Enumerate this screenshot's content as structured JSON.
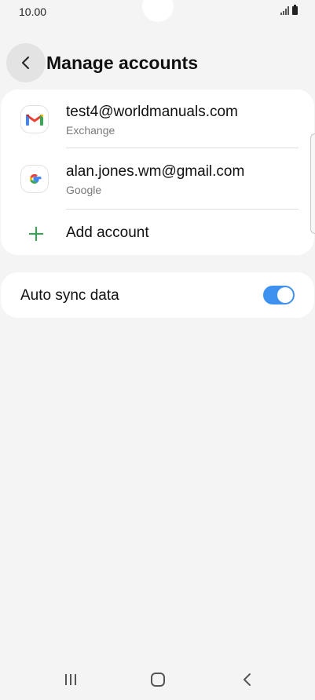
{
  "status_bar": {
    "time": "10.00",
    "icons": [
      "signal-icon",
      "battery-icon"
    ]
  },
  "header": {
    "title": "Manage accounts",
    "back_icon": "back-arrow-icon"
  },
  "accounts": [
    {
      "name": "test4@worldmanuals.com",
      "type": "Exchange",
      "icon": "gmail-icon"
    },
    {
      "name": "alan.jones.wm@gmail.com",
      "type": "Google",
      "icon": "google-icon"
    }
  ],
  "add_account": {
    "label": "Add account",
    "icon": "plus-icon",
    "color": "#2fa84f"
  },
  "sync": {
    "label": "Auto sync data",
    "enabled": true,
    "toggle_color": "#3e91ee"
  },
  "nav_bar": {
    "buttons": [
      "recents-icon",
      "home-icon",
      "back-icon"
    ]
  }
}
